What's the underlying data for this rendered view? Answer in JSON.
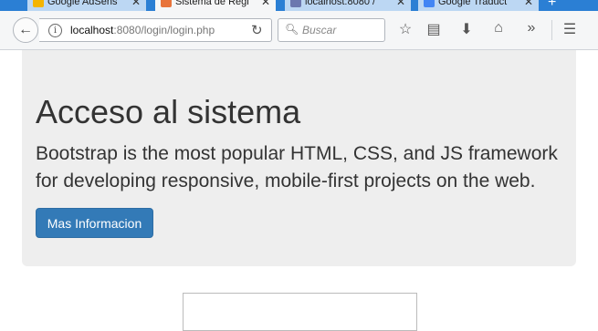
{
  "browser": {
    "tabs": [
      {
        "label": "Google AdSens",
        "active": false
      },
      {
        "label": "Sistema de Regi",
        "active": true
      },
      {
        "label": "localhost:8080 /",
        "active": false
      },
      {
        "label": "Google Traduct",
        "active": false
      }
    ],
    "url": "localhost:8080/login/login.php",
    "url_host": "localhost",
    "url_rest": ":8080/login/login.php",
    "search_placeholder": "Buscar"
  },
  "jumbotron": {
    "title": "Acceso al sistema",
    "lead": "Bootstrap is the most popular HTML, CSS, and JS framework for developing responsive, mobile-first projects on the web.",
    "button_label": "Mas Informacion"
  },
  "colors": {
    "primary": "#337ab7",
    "jumbotron_bg": "#eeeeee",
    "tabstrip": "#2b7fd4"
  }
}
